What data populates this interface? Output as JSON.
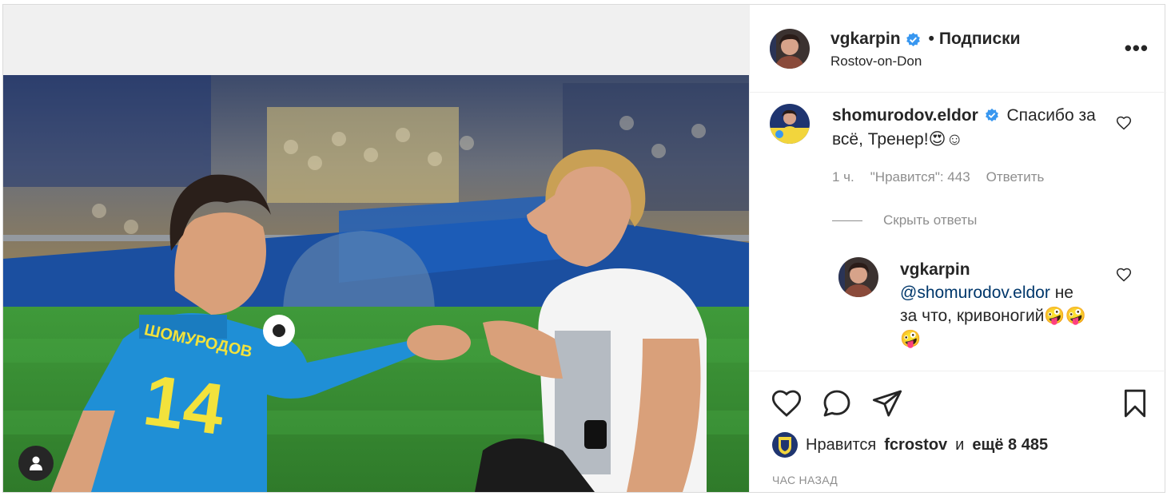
{
  "post": {
    "author": {
      "username": "vgkarpin",
      "verified": true,
      "separator": "•",
      "follow_label": "Подписки",
      "location": "Rostov-on-Don"
    },
    "more_label": "•••",
    "jersey": {
      "name": "ШОМУРОДОВ",
      "number": "14"
    }
  },
  "comments": [
    {
      "username": "shomurodov.eldor",
      "verified": true,
      "text": "Спасибо за всё, Тренер!😍☺",
      "age": "1 ч.",
      "likes": "\"Нравится\": 443",
      "reply_label": "Ответить",
      "hide_replies_label": "Скрыть ответы",
      "replies": [
        {
          "username": "vgkarpin",
          "mention": "@shomurodov.eldor",
          "text": " не за что, кривоногий🤪🤪🤪"
        }
      ]
    }
  ],
  "footer": {
    "liked_by_prefix": "Нравится",
    "liked_by_user": "fcrostov",
    "liked_by_and": "и",
    "liked_by_more": "ещё 8 485",
    "time_ago": "ЧАС НАЗАД"
  },
  "icons": {
    "like": "heart-icon",
    "comment": "comment-icon",
    "share": "share-icon",
    "save": "bookmark-icon",
    "tags": "user-tag-icon",
    "verified": "verified-badge-icon"
  },
  "colors": {
    "verified": "#3897f0",
    "text": "#262626",
    "muted": "#8e8e8e",
    "link": "#00376b",
    "jersey": "#1f8fd6",
    "jersey_number": "#f2e23c"
  }
}
